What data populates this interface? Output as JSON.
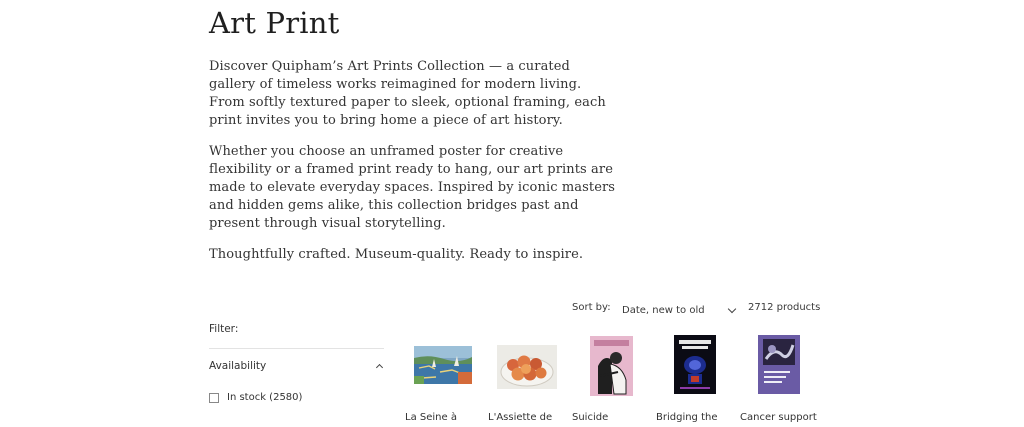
{
  "collection": {
    "title": "Art Print",
    "description": [
      "Discover Quipham’s Art Prints Collection — a curated gallery of timeless works reimagined for modern living. From softly textured paper to sleek, optional framing, each print invites you to bring home a piece of art history.",
      "Whether you choose an unframed poster for creative flexibility or a framed print ready to hang, our art prints are made to elevate everyday spaces. Inspired by iconic masters and hidden gems alike, this collection bridges past and present through visual storytelling.",
      "Thoughtfully crafted. Museum-quality. Ready to inspire."
    ]
  },
  "toolbar": {
    "sort_label": "Sort by:",
    "sort_value": "Date, new to old",
    "product_count": "2712 products"
  },
  "filters": {
    "label": "Filter:",
    "facets": [
      {
        "name": "Availability",
        "expanded": true,
        "options": [
          {
            "label": "In stock (2580)",
            "checked": false
          }
        ]
      }
    ]
  },
  "products": [
    {
      "title": "La Seine à",
      "thumb": "impressionist-riverscape"
    },
    {
      "title": "L'Assiette de",
      "thumb": "still-life-fruit-plate"
    },
    {
      "title": "Suicide",
      "thumb": "pink-poster-figure"
    },
    {
      "title": "Bridging the",
      "thumb": "dark-poster-bridging-the-gap"
    },
    {
      "title": "Cancer support",
      "thumb": "purple-poster-cancer-support"
    }
  ],
  "colors": {
    "text": "#2b2b2b",
    "divider": "#e3e3e3"
  }
}
